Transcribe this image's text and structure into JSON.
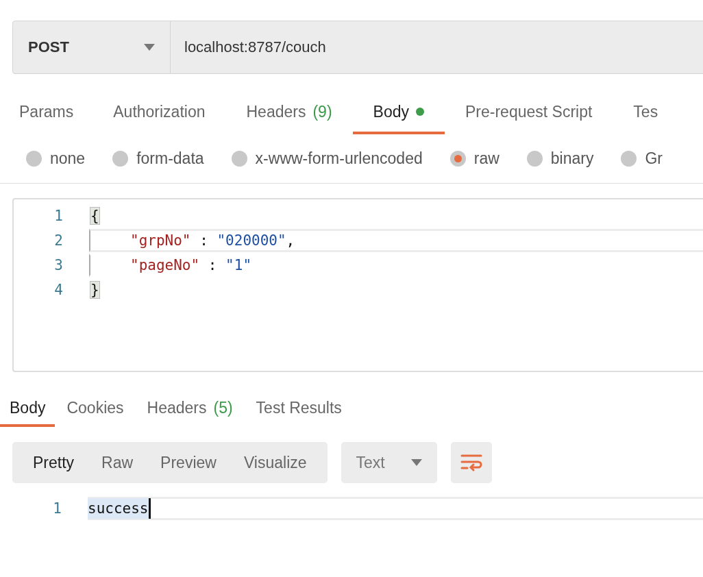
{
  "request": {
    "method": "POST",
    "url": "localhost:8787/couch"
  },
  "request_tabs": [
    {
      "label": "Params",
      "selected": false
    },
    {
      "label": "Authorization",
      "selected": false
    },
    {
      "label": "Headers",
      "count": "(9)",
      "selected": false
    },
    {
      "label": "Body",
      "has_content": true,
      "selected": true
    },
    {
      "label": "Pre-request Script",
      "selected": false
    },
    {
      "label": "Tes",
      "selected": false
    }
  ],
  "body_types": [
    {
      "label": "none",
      "selected": false
    },
    {
      "label": "form-data",
      "selected": false
    },
    {
      "label": "x-www-form-urlencoded",
      "selected": false
    },
    {
      "label": "raw",
      "selected": true
    },
    {
      "label": "binary",
      "selected": false
    },
    {
      "label": "Gr",
      "selected": false
    }
  ],
  "editor": {
    "lines": [
      {
        "number": "1",
        "indented": false,
        "active": false,
        "tokens": [
          {
            "kind": "brace",
            "text": "{",
            "matched": true
          }
        ]
      },
      {
        "number": "2",
        "indented": true,
        "active": true,
        "tokens": [
          {
            "kind": "key",
            "text": "\"grpNo\""
          },
          {
            "kind": "punct",
            "text": " : "
          },
          {
            "kind": "string",
            "text": "\"020000\""
          },
          {
            "kind": "punct",
            "text": ","
          }
        ]
      },
      {
        "number": "3",
        "indented": true,
        "active": false,
        "tokens": [
          {
            "kind": "key",
            "text": "\"pageNo\""
          },
          {
            "kind": "punct",
            "text": " : "
          },
          {
            "kind": "string",
            "text": "\"1\""
          }
        ]
      },
      {
        "number": "4",
        "indented": false,
        "active": false,
        "tokens": [
          {
            "kind": "brace",
            "text": "}",
            "matched": true
          }
        ]
      }
    ]
  },
  "response_tabs": [
    {
      "label": "Body",
      "selected": true
    },
    {
      "label": "Cookies",
      "selected": false
    },
    {
      "label": "Headers",
      "count": "(5)",
      "selected": false
    },
    {
      "label": "Test Results",
      "selected": false
    }
  ],
  "view_modes": [
    {
      "label": "Pretty",
      "selected": true
    },
    {
      "label": "Raw",
      "selected": false
    },
    {
      "label": "Preview",
      "selected": false
    },
    {
      "label": "Visualize",
      "selected": false
    }
  ],
  "format": "Text",
  "response": {
    "lines": [
      {
        "number": "1",
        "text": "success",
        "selected": true,
        "cursor": true
      }
    ]
  }
}
